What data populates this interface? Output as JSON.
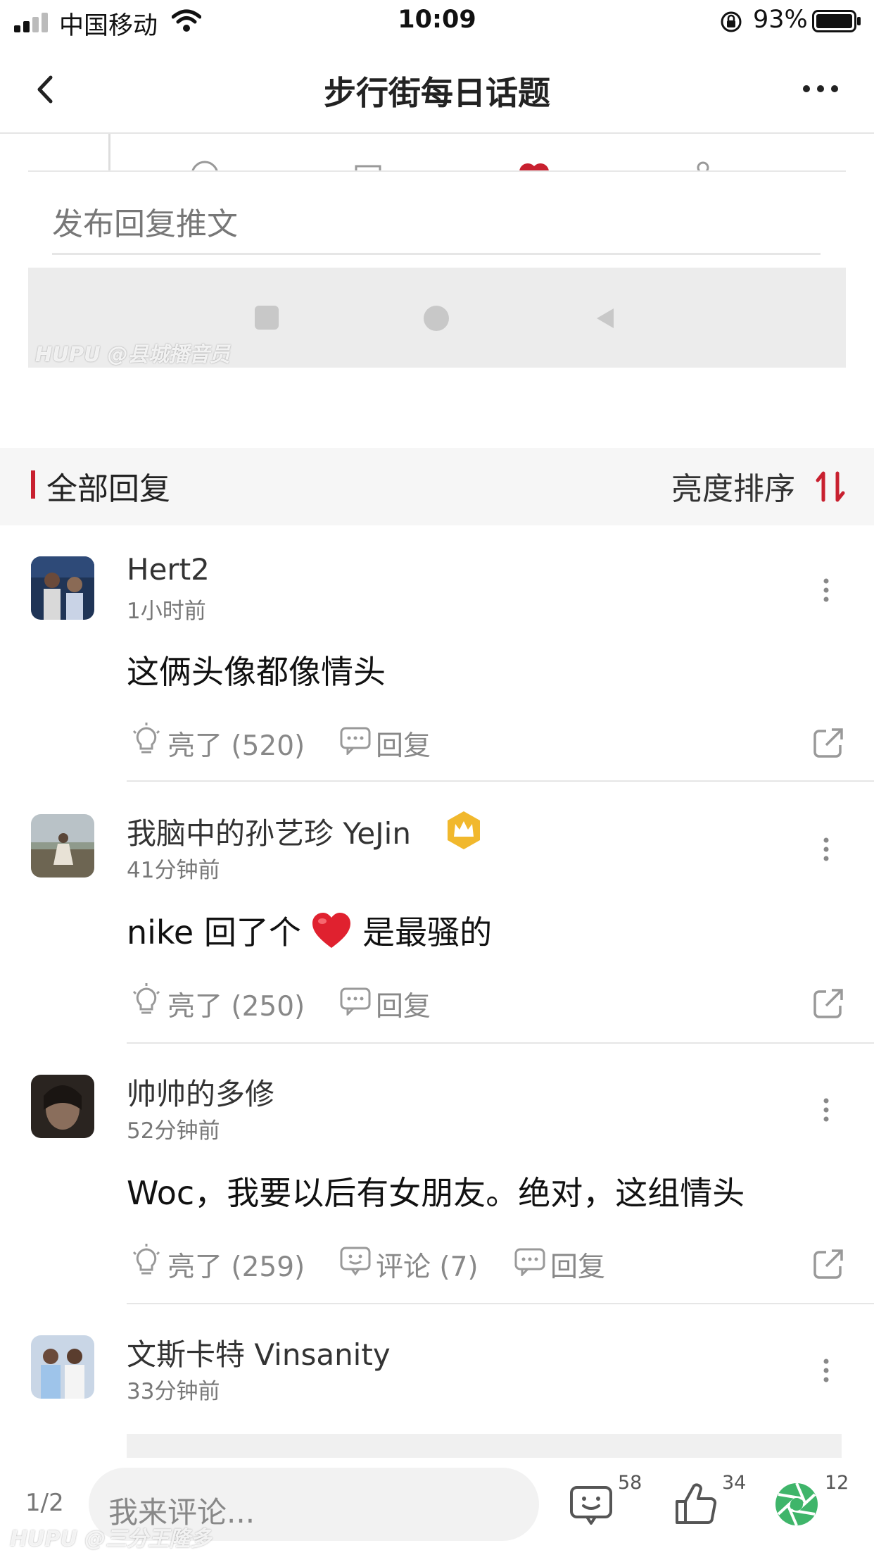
{
  "status_bar": {
    "carrier": "中国移动",
    "time": "10:09",
    "battery_percent": "93%"
  },
  "nav": {
    "title": "步行街每日话题"
  },
  "post_area": {
    "reply_placeholder": "发布回复推文",
    "watermark_top": "HUPU @县城播音员"
  },
  "section": {
    "title": "全部回复",
    "sort_label": "亮度排序",
    "accent_color": "#c8202f"
  },
  "comments": [
    {
      "username": "Hert2",
      "time": "1小时前",
      "text": "这俩头像都像情头",
      "light_label": "亮了 (520)",
      "reply_label": "回复"
    },
    {
      "username": "我脑中的孙艺珍 YeJin",
      "time": "41分钟前",
      "text_before": "nike 回了个",
      "emoji": "❤️",
      "text_after": "是最骚的",
      "light_label": "亮了 (250)",
      "reply_label": "回复",
      "badge": "crown-icon"
    },
    {
      "username": "帅帅的多修",
      "time": "52分钟前",
      "text": "Woc，我要以后有女朋友。绝对，这组情头",
      "light_label": "亮了 (259)",
      "comment_label": "评论 (7)",
      "reply_label": "回复"
    },
    {
      "username": "文斯卡特 Vinsanity",
      "time": "33分钟前"
    }
  ],
  "bottom_bar": {
    "page_indicator": "1/2",
    "comment_placeholder": "我来评论...",
    "comments_count": "58",
    "likes_count": "34",
    "share_count": "12",
    "watermark": "HUPU @三分王隆多"
  }
}
